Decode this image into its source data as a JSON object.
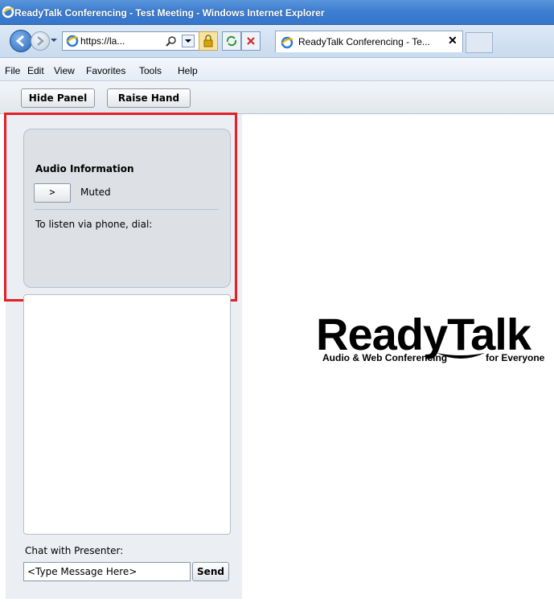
{
  "window": {
    "title": "ReadyTalk Conferencing - Test Meeting - Windows Internet Explorer"
  },
  "navbar": {
    "address_text": "https://la...",
    "tab_label": "ReadyTalk Conferencing - Te...",
    "tab_close": "✕"
  },
  "menu": {
    "items": [
      "File",
      "Edit",
      "View",
      "Favorites",
      "Tools",
      "Help"
    ]
  },
  "toolbar": {
    "hide_panel": "Hide Panel",
    "raise_hand": "Raise Hand"
  },
  "audio": {
    "title": "Audio Information",
    "expand_label": ">",
    "status": "Muted",
    "dial_text": "To listen via phone, dial:"
  },
  "chat": {
    "label": "Chat with Presenter:",
    "placeholder": "<Type Message Here>",
    "send": "Send"
  },
  "logo": {
    "brand": "ReadyTalk",
    "tagline_left": "Audio & Web Conferencing",
    "tagline_right": "for Everyone"
  },
  "colors": {
    "titlebar": "#3f7fd1",
    "highlight": "#e61e25",
    "panel_bg": "#ebeef2",
    "card_bg": "#dde1e5"
  },
  "icons": [
    "ie-logo-icon",
    "back-arrow-icon",
    "forward-arrow-icon",
    "search-icon",
    "lock-icon",
    "refresh-icon",
    "stop-icon",
    "tab-page-icon"
  ]
}
